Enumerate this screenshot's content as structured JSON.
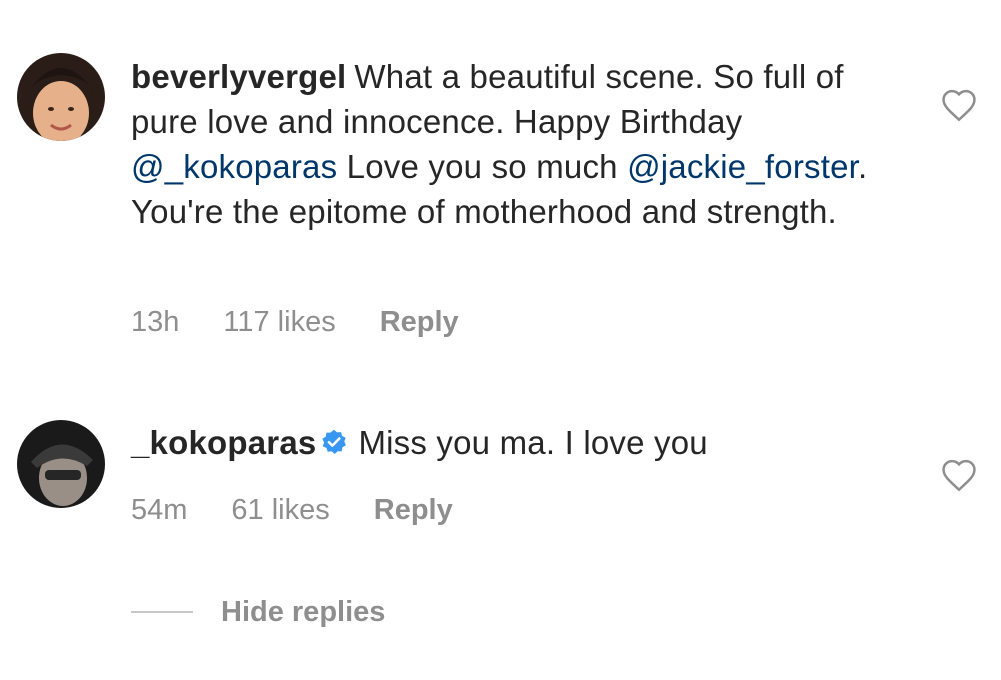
{
  "comments": [
    {
      "username": "beverlyvergel",
      "text_parts": [
        "What a beautiful scene. So full of pure love and innocence. Happy Birthday ",
        "@_kokoparas",
        "  Love you so much ",
        "@jackie_forster",
        ". You're the epitome of motherhood and strength."
      ],
      "time": "13h",
      "likes": "117 likes",
      "reply": "Reply"
    },
    {
      "username": "_kokoparas",
      "verified": true,
      "text": "Miss you ma. I love you",
      "time": "54m",
      "likes": "61 likes",
      "reply": "Reply"
    }
  ],
  "hide_replies": "Hide replies",
  "colors": {
    "mention": "#00376b",
    "muted": "#8e8e8e",
    "verified": "#3897f0"
  },
  "icons": [
    "heart-outline-icon",
    "verified-badge-icon"
  ]
}
